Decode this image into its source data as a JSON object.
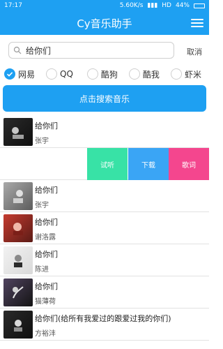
{
  "status": {
    "time": "17:17",
    "speed": "5.60K/s",
    "network": "HD",
    "battery": "44%"
  },
  "app": {
    "title": "Cy音乐助手"
  },
  "search": {
    "value": "给你们",
    "cancel": "取消"
  },
  "sources": [
    {
      "label": "网易",
      "selected": true
    },
    {
      "label": "QQ",
      "selected": false
    },
    {
      "label": "酷狗",
      "selected": false
    },
    {
      "label": "酷我",
      "selected": false
    },
    {
      "label": "虾米",
      "selected": false
    }
  ],
  "actions": {
    "search_button": "点击搜索音乐",
    "listen": "试听",
    "download": "下载",
    "lyrics": "歌词"
  },
  "results": [
    {
      "title": "给你们",
      "artist": "张宇"
    },
    {
      "title": "给你们",
      "artist": "张宇"
    },
    {
      "title": "给你们",
      "artist": "谢洛露"
    },
    {
      "title": "给你们",
      "artist": "陈进"
    },
    {
      "title": "给你们",
      "artist": "猫薄荷"
    },
    {
      "title": "给你们(给所有我爱过的跟爱过我的你们)",
      "artist": "方裕沣"
    }
  ],
  "colors": {
    "primary": "#1ea0f2",
    "listen": "#38e2a6",
    "download": "#3aa5f5",
    "lyrics": "#f4468e"
  }
}
